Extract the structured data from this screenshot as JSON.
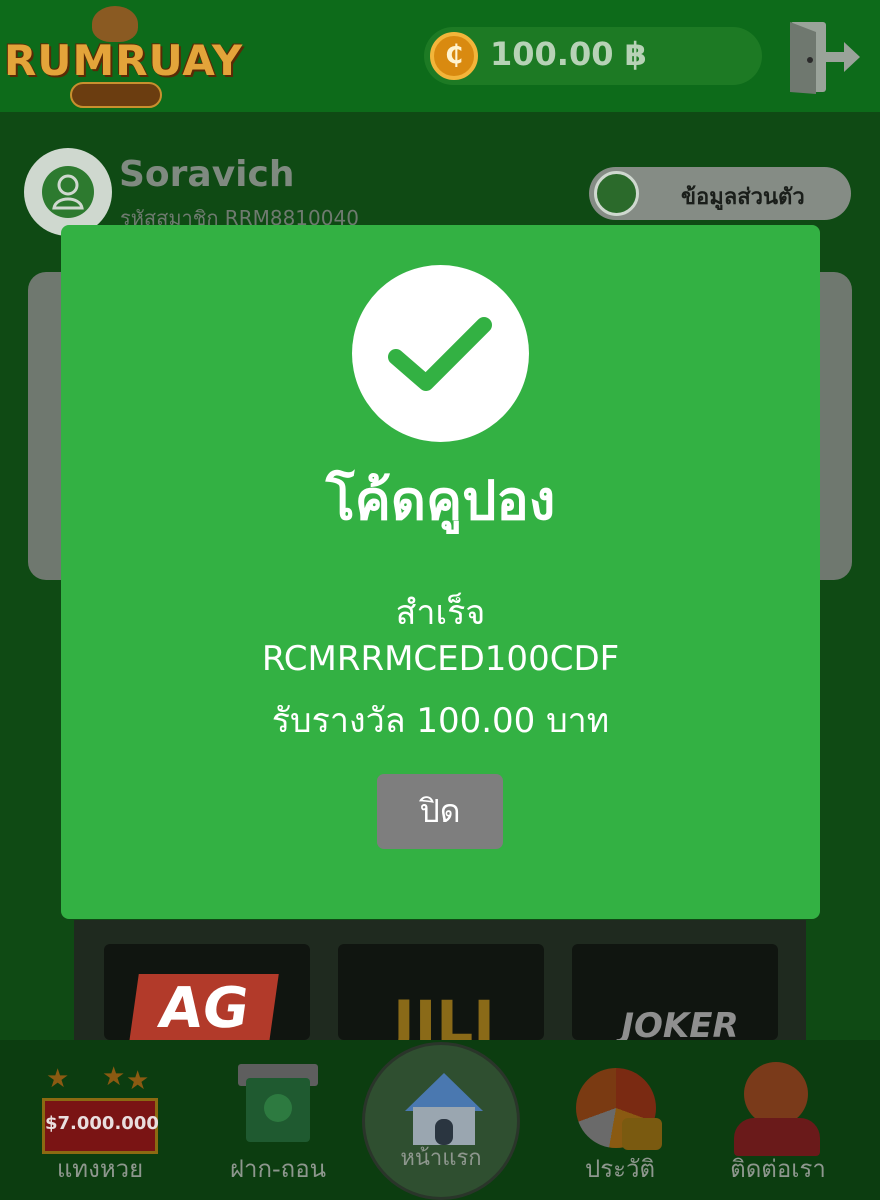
{
  "header": {
    "logo_text": "RUMRUAY",
    "balance": "100.00 ฿",
    "coin_glyph": "₵"
  },
  "profile": {
    "username": "Soravich",
    "member_id": "รหัสสมาชิก RRM8810040",
    "profile_button": "ข้อมูลส่วนตัว"
  },
  "games": [
    "AG",
    "JILI",
    "JOKER"
  ],
  "bottom_nav": [
    {
      "label": "แทงหวย",
      "icon": "lottery-board-icon"
    },
    {
      "label": "ฝาก-ถอน",
      "icon": "atm-icon"
    },
    {
      "label": "หน้าแรก",
      "icon": "home-icon"
    },
    {
      "label": "ประวัติ",
      "icon": "pie-chart-icon"
    },
    {
      "label": "ติดต่อเรา",
      "icon": "support-agent-icon"
    }
  ],
  "lotto_amount": "$7.000.000",
  "modal": {
    "title": "โค้ดคูปอง",
    "status": "สำเร็จ",
    "code": "RCMRRMCED100CDF",
    "reward": "รับรางวัล 100.00 บาท",
    "close_label": "ปิด",
    "icon": "checkmark-icon"
  },
  "colors": {
    "modal_green": "#33b143",
    "close_button": "#7e7e7e",
    "header_green": "#0d6b1a"
  }
}
